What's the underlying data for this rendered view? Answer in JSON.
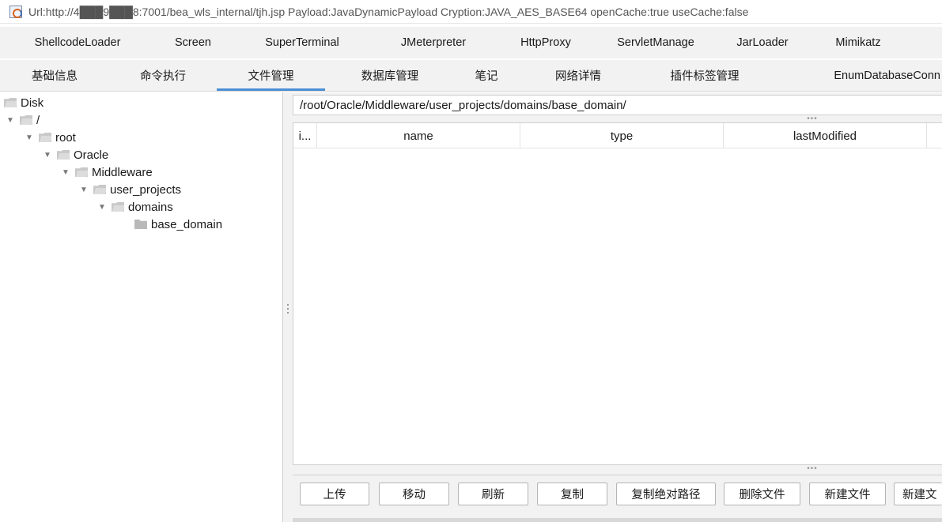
{
  "window": {
    "title": "Url:http://4███9███8:7001/bea_wls_internal/tjh.jsp Payload:JavaDynamicPayload Cryption:JAVA_AES_BASE64 openCache:true useCache:false",
    "icon": "java-cup-icon"
  },
  "plugin_tabs": [
    {
      "label": "ShellcodeLoader"
    },
    {
      "label": "Screen"
    },
    {
      "label": "SuperTerminal"
    },
    {
      "label": "JMeterpreter"
    },
    {
      "label": "HttpProxy"
    },
    {
      "label": "ServletManage"
    },
    {
      "label": "JarLoader"
    },
    {
      "label": "Mimikatz"
    }
  ],
  "main_tabs": [
    {
      "label": "基础信息"
    },
    {
      "label": "命令执行"
    },
    {
      "label": "文件管理",
      "active": true
    },
    {
      "label": "数据库管理"
    },
    {
      "label": "笔记"
    },
    {
      "label": "网络详情"
    },
    {
      "label": "插件标签管理"
    },
    {
      "label": "EnumDatabaseConn"
    }
  ],
  "tree": {
    "root_label": "Disk",
    "nodes": [
      {
        "label": "/",
        "expanded": true
      },
      {
        "label": "root",
        "expanded": true
      },
      {
        "label": "Oracle",
        "expanded": true
      },
      {
        "label": "Middleware",
        "expanded": true
      },
      {
        "label": "user_projects",
        "expanded": true
      },
      {
        "label": "domains",
        "expanded": true
      },
      {
        "label": "base_domain",
        "expanded": false
      }
    ]
  },
  "file_manager": {
    "current_path": "/root/Oracle/Middleware/user_projects/domains/base_domain/",
    "columns": [
      "i...",
      "name",
      "type",
      "lastModified"
    ],
    "rows": [],
    "buttons": [
      {
        "label": "上传"
      },
      {
        "label": "移动"
      },
      {
        "label": "刷新"
      },
      {
        "label": "复制"
      },
      {
        "label": "复制绝对路径"
      },
      {
        "label": "删除文件"
      },
      {
        "label": "新建文件"
      },
      {
        "label": "新建文"
      }
    ]
  },
  "colors": {
    "active_tab_underline": "#4a8fd4",
    "panel_bg": "#f2f2f2"
  }
}
